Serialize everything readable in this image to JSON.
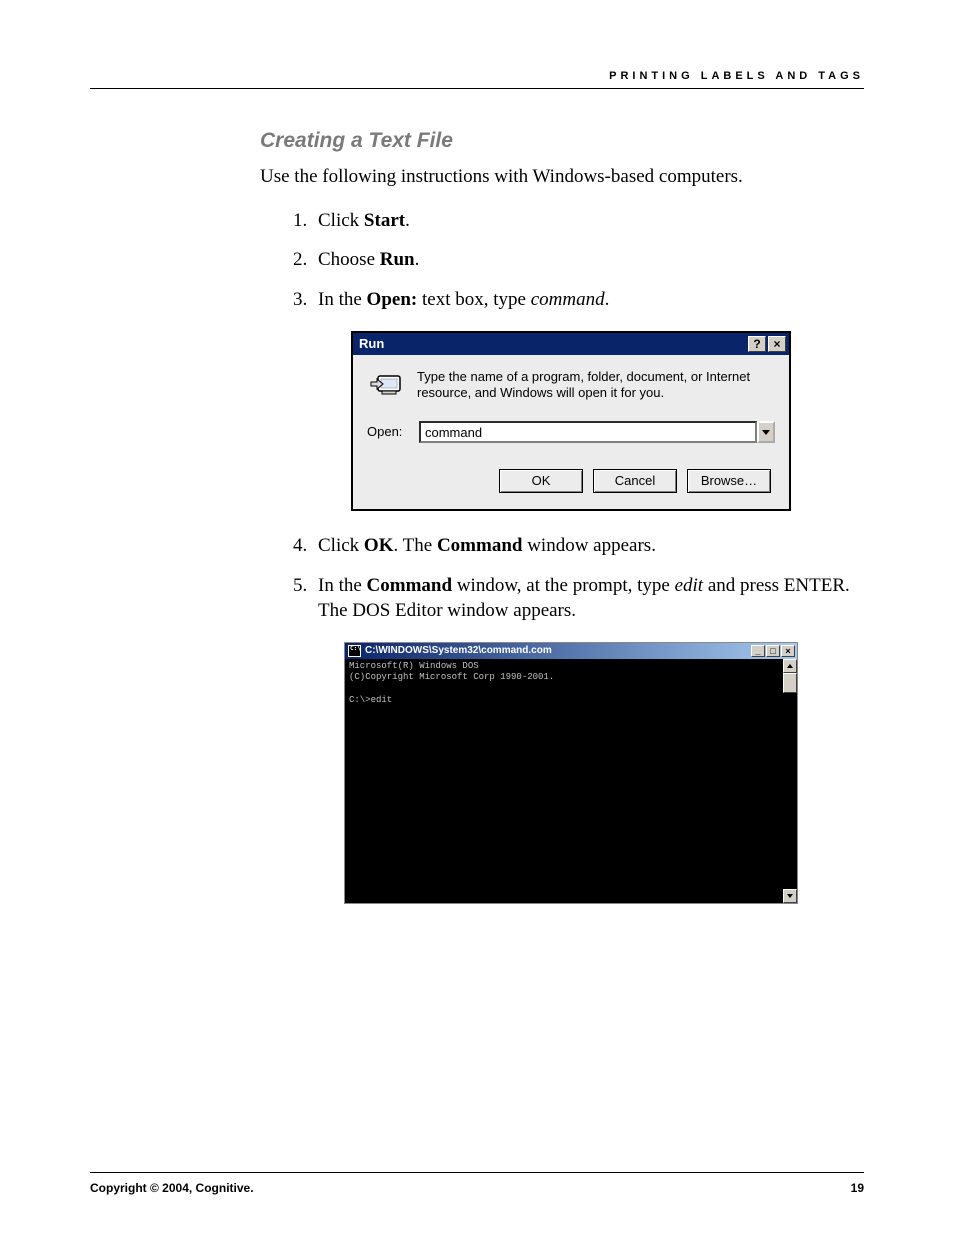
{
  "header": {
    "running_head": "PRINTING LABELS AND TAGS"
  },
  "section": {
    "title": "Creating a Text File",
    "intro": "Use the following instructions with Windows-based computers.",
    "steps": {
      "s1_pre": "Click ",
      "s1_bold": "Start",
      "s1_post": ".",
      "s2_pre": "Choose ",
      "s2_bold": "Run",
      "s2_post": ".",
      "s3_pre": "In the ",
      "s3_bold": "Open:",
      "s3_mid": " text box, type ",
      "s3_ital": "command",
      "s3_post": ".",
      "s4_pre": "Click ",
      "s4_bold1": "OK",
      "s4_mid": ". The ",
      "s4_bold2": "Command",
      "s4_post": " window appears.",
      "s5_pre": "In the ",
      "s5_bold": "Command",
      "s5_mid": " window, at the prompt, type ",
      "s5_ital": "edit",
      "s5_post": " and press ENTER. The DOS Editor window appears."
    }
  },
  "run_dialog": {
    "title": "Run",
    "help_glyph": "?",
    "close_glyph": "×",
    "description": "Type the name of a program, folder, document, or Internet resource, and Windows will open it for you.",
    "open_label": "Open:",
    "open_value": "command",
    "buttons": {
      "ok": "OK",
      "cancel": "Cancel",
      "browse": "Browse…"
    }
  },
  "cmd_window": {
    "title": "C:\\WINDOWS\\System32\\command.com",
    "min_glyph": "_",
    "max_glyph": "□",
    "close_glyph": "×",
    "line1": "Microsoft(R) Windows DOS",
    "line2": "(C)Copyright Microsoft Corp 1990-2001.",
    "blank": "",
    "prompt": "C:\\>edit"
  },
  "footer": {
    "copyright": "Copyright © 2004, Cognitive.",
    "page_num": "19"
  }
}
